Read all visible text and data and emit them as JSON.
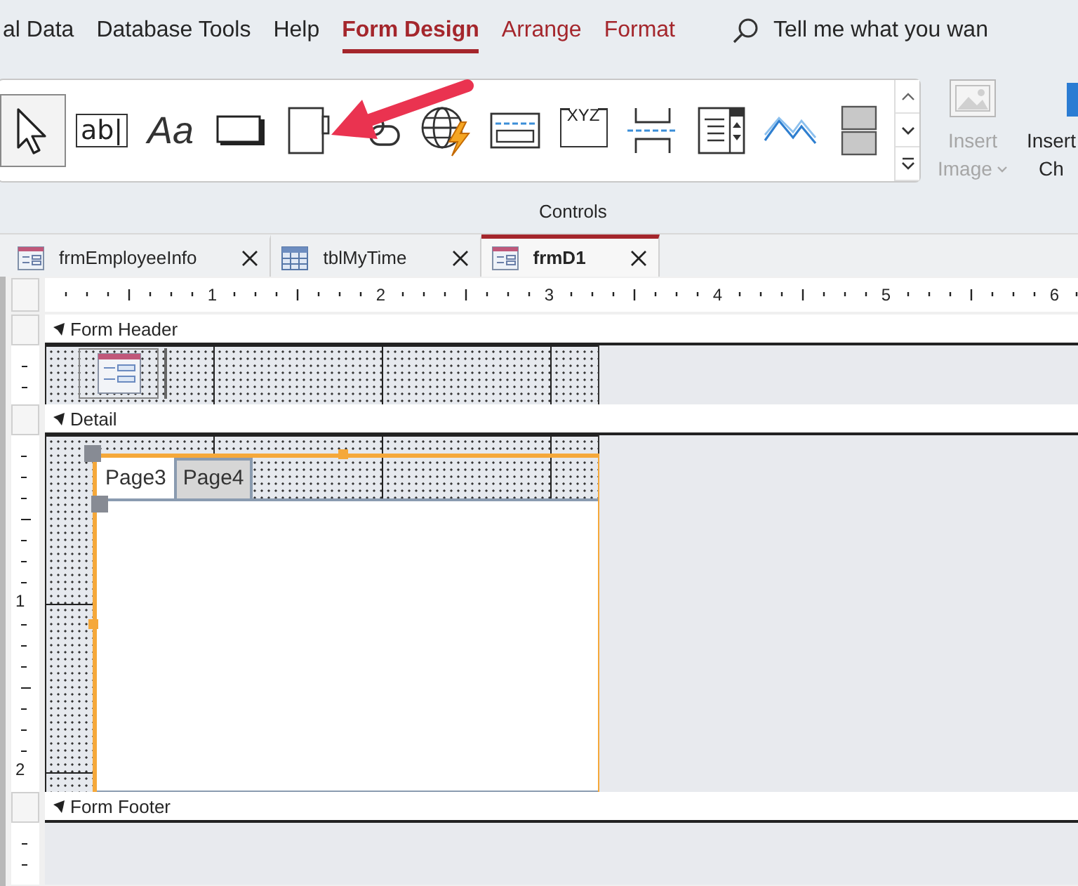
{
  "ribbon_tabs": [
    {
      "label": "al Data",
      "selected": false,
      "kind": "normal"
    },
    {
      "label": "Database Tools",
      "selected": false,
      "kind": "normal"
    },
    {
      "label": "Help",
      "selected": false,
      "kind": "normal"
    },
    {
      "label": "Form Design",
      "selected": true,
      "kind": "contextual"
    },
    {
      "label": "Arrange",
      "selected": false,
      "kind": "contextual"
    },
    {
      "label": "Format",
      "selected": false,
      "kind": "contextual"
    }
  ],
  "tell_me": {
    "placeholder": "Tell me what you wan"
  },
  "controls_gallery": {
    "label": "Controls",
    "tools": [
      {
        "kind": "pointer",
        "selected": true
      },
      {
        "kind": "textbox",
        "glyph": "ab|",
        "selected": false
      },
      {
        "kind": "label",
        "glyph": "Aa",
        "selected": false
      },
      {
        "kind": "button",
        "selected": false
      },
      {
        "kind": "tab-control",
        "selected": false
      },
      {
        "kind": "hyperlink",
        "selected": false
      },
      {
        "kind": "web-browser",
        "selected": false
      },
      {
        "kind": "navigation",
        "selected": false
      },
      {
        "kind": "option-group",
        "glyph": "XYZ",
        "selected": false
      },
      {
        "kind": "page-break",
        "selected": false
      },
      {
        "kind": "combo-box",
        "selected": false
      },
      {
        "kind": "line-chart",
        "selected": false
      },
      {
        "kind": "rectangle",
        "selected": false
      }
    ]
  },
  "insert_buttons": [
    {
      "lines": [
        "Insert",
        "Image"
      ],
      "disabled": true,
      "dropdown": true
    },
    {
      "lines": [
        "Insert",
        "Ch"
      ],
      "disabled": false,
      "dropdown": false
    }
  ],
  "document_tabs": [
    {
      "label": "frmEmployeeInfo",
      "kind": "form",
      "selected": false
    },
    {
      "label": "tblMyTime",
      "kind": "table",
      "selected": false
    },
    {
      "label": "frmD1",
      "kind": "form",
      "selected": true
    }
  ],
  "ruler": {
    "labels": [
      "1",
      "2",
      "3",
      "4",
      "5",
      "6"
    ]
  },
  "vertical_ruler": {
    "labels": [
      "1",
      "2"
    ]
  },
  "sections": [
    {
      "title": "Form Header"
    },
    {
      "title": "Detail"
    },
    {
      "title": "Form Footer"
    }
  ],
  "tab_control": {
    "selected": true,
    "pages": [
      {
        "label": "Page3",
        "selected": true
      },
      {
        "label": "Page4",
        "selected": false
      }
    ]
  }
}
